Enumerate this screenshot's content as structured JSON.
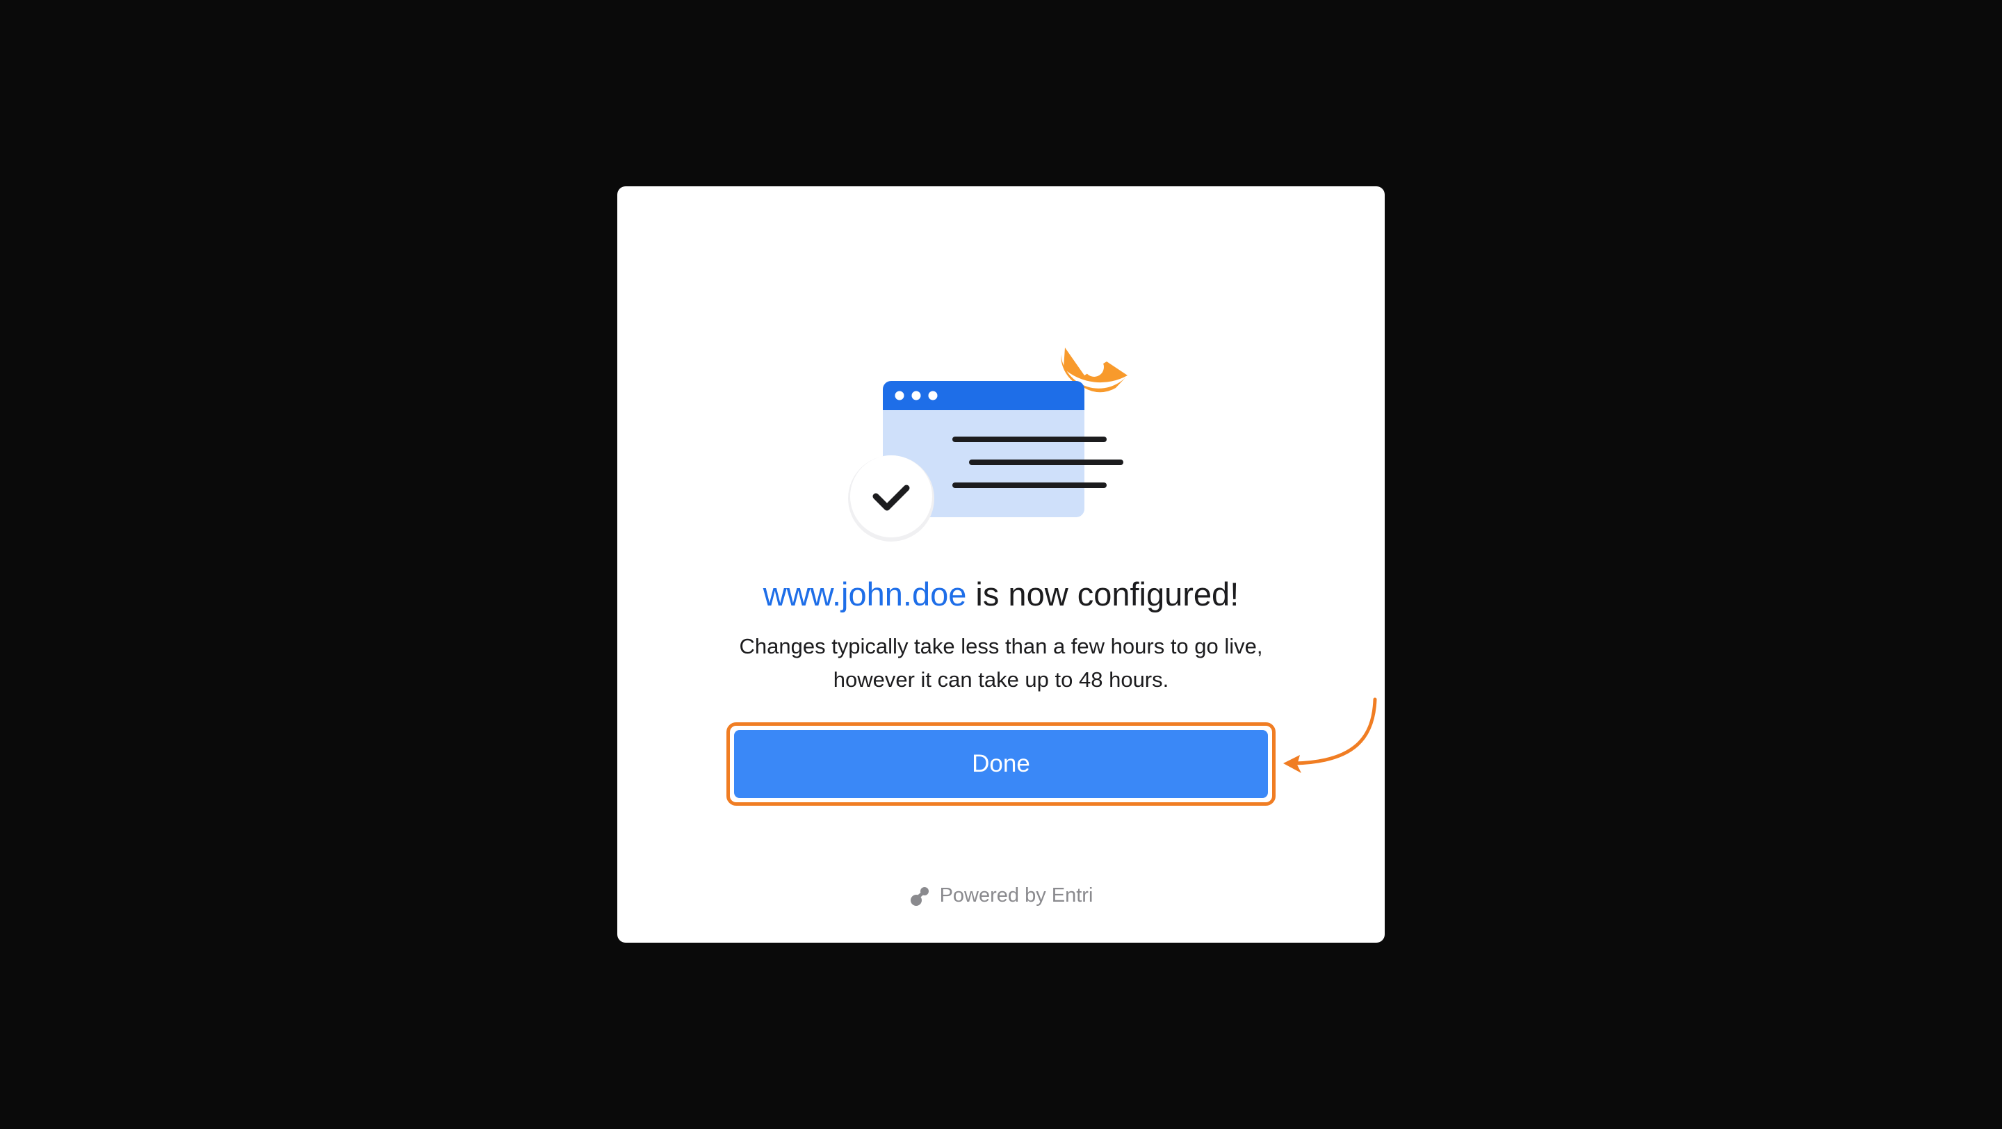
{
  "dialog": {
    "domain_text": "www.john.doe",
    "headline_suffix": " is now configured!",
    "description": "Changes typically take less than a few hours to go live, however it can take up to 48 hours.",
    "done_label": "Done",
    "powered_by": "Powered by Entri"
  },
  "icons": {
    "illustration": "browser-window-check-illustration",
    "check": "check-icon",
    "entri_logo": "entri-logo-icon",
    "annotation_arrow": "annotation-arrow-icon"
  },
  "colors": {
    "backdrop": "#0a0a0a",
    "accent_blue": "#1e6ee8",
    "button_blue": "#3a88f7",
    "highlight_orange": "#f07d23"
  }
}
